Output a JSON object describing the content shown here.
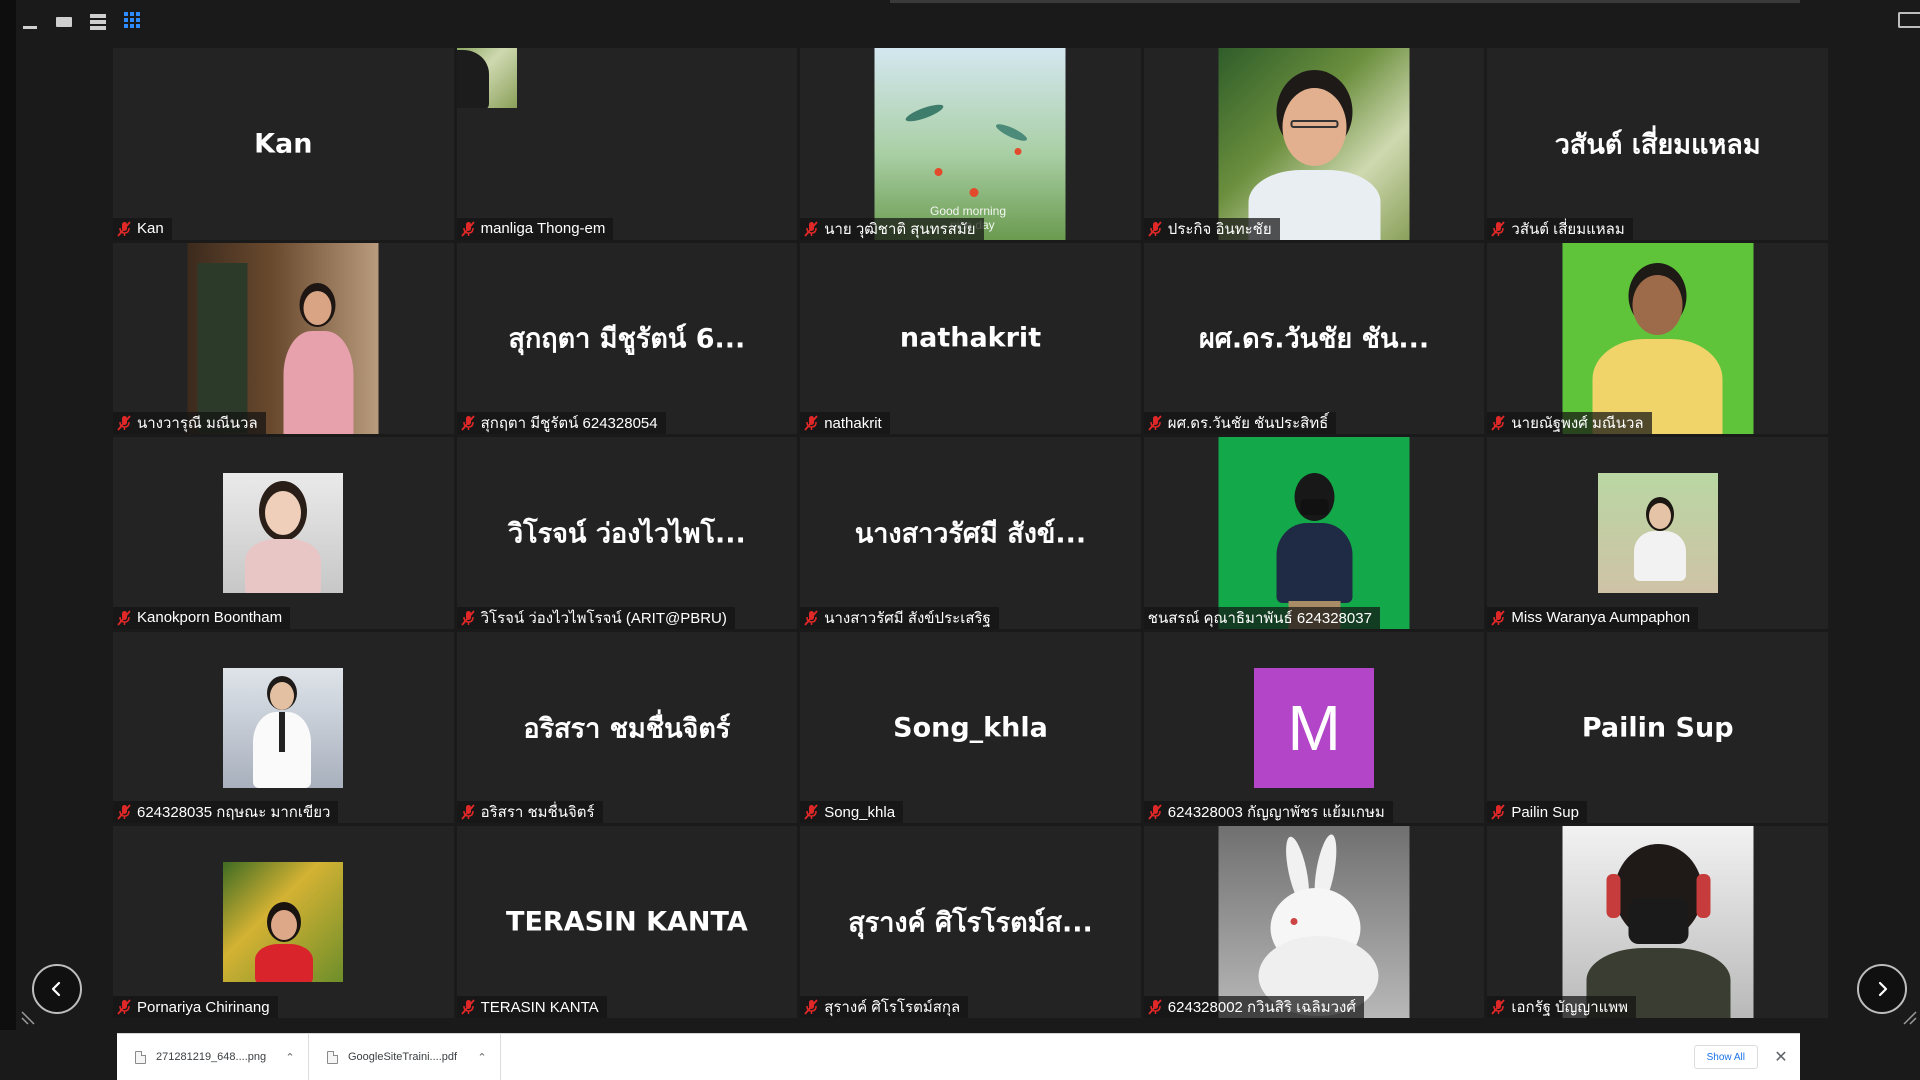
{
  "toolbar": {
    "icons": [
      "minimize-icon",
      "film-strip-icon",
      "speaker-view-icon",
      "gallery-view-icon"
    ]
  },
  "colors": {
    "background": "#1a1a1a",
    "tile": "#232323",
    "accent_blue": "#2d8cff",
    "muted_red": "#e02828",
    "initial_avatar": "#b245c8"
  },
  "participants": [
    {
      "tile": "name",
      "display": "Kan",
      "label": "Kan"
    },
    {
      "tile": "avatar",
      "label": "manliga Thong-em"
    },
    {
      "tile": "video",
      "label": "นาย วุฒิชาติ สุนทรสมัย",
      "overlay": "Good morning\nnice day"
    },
    {
      "tile": "video",
      "label": "ประกิจ อินทะชัย"
    },
    {
      "tile": "name",
      "display": "วสันต์ เสี่ยมแหลม",
      "label": "วสันต์ เสี่ยมแหลม"
    },
    {
      "tile": "video",
      "label": "นางวารุณี มณีนวล"
    },
    {
      "tile": "name",
      "display": "สุกฤตา มีชูรัตน์ 6...",
      "label": "สุกฤตา มีชูรัตน์ 624328054"
    },
    {
      "tile": "name",
      "display": "nathakrit",
      "label": "nathakrit"
    },
    {
      "tile": "name",
      "display": "ผศ.ดร.วันชัย ชัน...",
      "label": "ผศ.ดร.วันชัย ชันประสิทธิ์"
    },
    {
      "tile": "video",
      "label": "นายณัฐพงศ์ มณีนวล"
    },
    {
      "tile": "avatar",
      "label": "Kanokporn Boontham"
    },
    {
      "tile": "name",
      "display": "วิโรจน์ ว่องไวไพโ...",
      "label": "วิโรจน์ ว่องไวไพโรจน์  (ARIT@PBRU)"
    },
    {
      "tile": "name",
      "display": "นางสาวรัศมี สังข์...",
      "label": "นางสาวรัศมี สังข์ประเสริฐ"
    },
    {
      "tile": "video",
      "label": "ชนสรณ์ คุณาธิมาพันธ์ 624328037"
    },
    {
      "tile": "avatar",
      "label": "Miss Waranya Aumpaphon"
    },
    {
      "tile": "avatar",
      "label": "624328035 กฤษณะ มากเขียว"
    },
    {
      "tile": "name",
      "display": "อริสรา ชมชื่นจิตร์",
      "label": "อริสรา ชมชื่นจิตร์"
    },
    {
      "tile": "name",
      "display": "Song_khla",
      "label": "Song_khla"
    },
    {
      "tile": "initial",
      "initial": "M",
      "label": "624328003 กัญญาพัชร แย้มเกษม"
    },
    {
      "tile": "name",
      "display": "Pailin Sup",
      "label": "Pailin Sup"
    },
    {
      "tile": "avatar",
      "label": "Pornariya Chirinang"
    },
    {
      "tile": "name",
      "display": "TERASIN KANTA",
      "label": "TERASIN KANTA"
    },
    {
      "tile": "name",
      "display": "สุรางค์ ศิโรโรตม์ส...",
      "label": "สุรางค์ ศิโรโรตม์สกุล"
    },
    {
      "tile": "video",
      "label": "624328002 กวินสิริ เฉลิมวงศ์"
    },
    {
      "tile": "video",
      "label": "เอกรัฐ บัญญาแพพ"
    }
  ],
  "navigation": {
    "prev_icon": "chevron-left-icon",
    "next_icon": "chevron-right-icon"
  },
  "downloads": {
    "items": [
      {
        "name": "271281219_648....png"
      },
      {
        "name": "GoogleSiteTraini....pdf"
      }
    ],
    "show_all": "Show All",
    "close_icon": "close-icon"
  }
}
